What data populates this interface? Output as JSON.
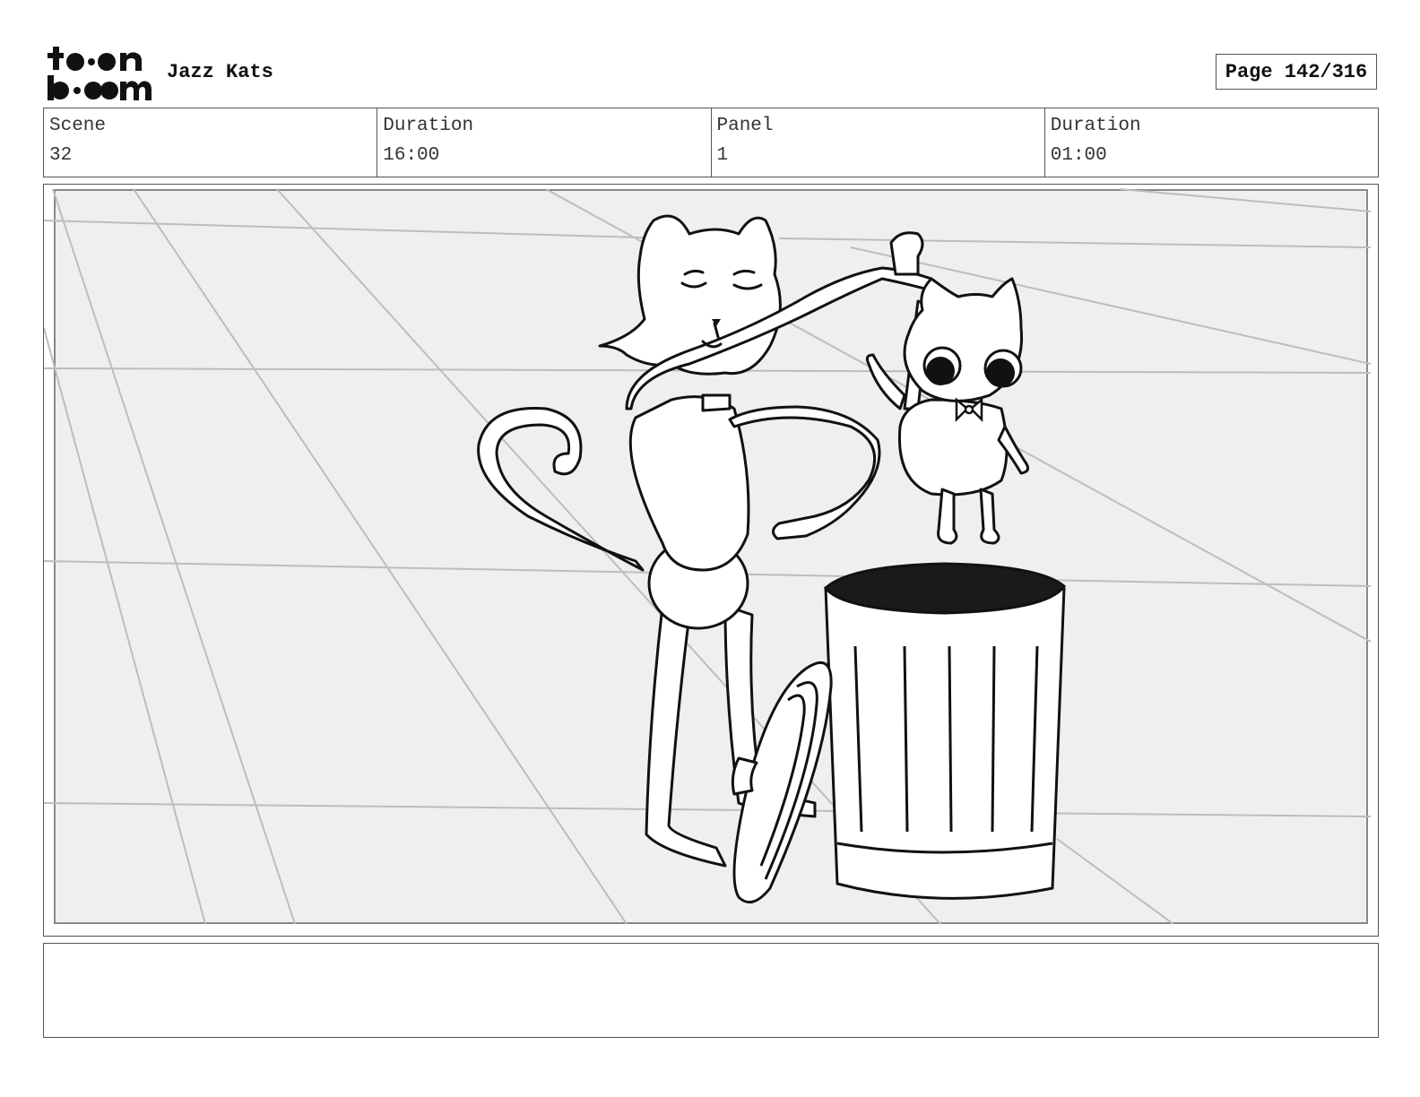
{
  "header": {
    "logo_text": "toonboom",
    "project_title": "Jazz Kats",
    "page_indicator": "Page 142/316"
  },
  "info": {
    "scene_label": "Scene",
    "scene_value": "32",
    "scene_duration_label": "Duration",
    "scene_duration_value": "16:00",
    "panel_label": "Panel",
    "panel_value": "1",
    "panel_duration_label": "Duration",
    "panel_duration_value": "01:00"
  },
  "panel": {
    "image_icon": "storyboard-sketch-image"
  },
  "notes": {
    "text": ""
  }
}
